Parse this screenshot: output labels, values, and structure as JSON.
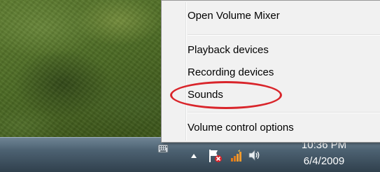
{
  "context_menu": {
    "items": [
      {
        "label": "Open Volume Mixer"
      },
      {
        "label": "Playback devices"
      },
      {
        "label": "Recording devices"
      },
      {
        "label": "Sounds"
      },
      {
        "label": "Volume control options"
      }
    ],
    "highlighted_item": "Sounds",
    "highlight_color": "#d9252b"
  },
  "tray": {
    "icons": [
      "keyboard-icon",
      "show-hidden-icons-arrow",
      "action-center-flag-icon",
      "network-icon",
      "volume-icon"
    ]
  },
  "clock": {
    "time": "10:36 PM",
    "date": "6/4/2009"
  }
}
